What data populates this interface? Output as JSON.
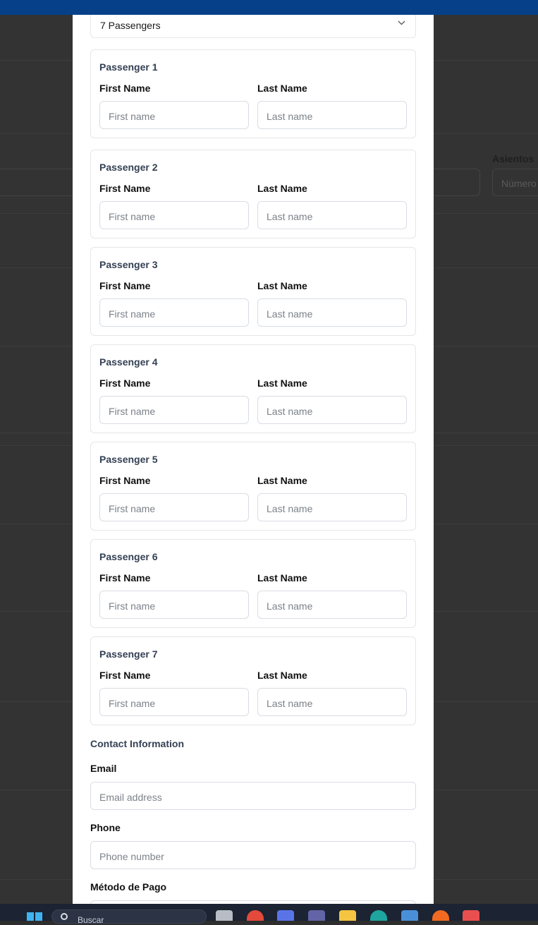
{
  "background": {
    "label": "Asientos",
    "input_placeholder": "Número"
  },
  "form": {
    "passenger_count_select": "7 Passengers",
    "passengers": [
      {
        "title": "Passenger 1",
        "first_label": "First Name",
        "last_label": "Last Name",
        "first_placeholder": "First name",
        "last_placeholder": "Last name"
      },
      {
        "title": "Passenger 2",
        "first_label": "First Name",
        "last_label": "Last Name",
        "first_placeholder": "First name",
        "last_placeholder": "Last name"
      },
      {
        "title": "Passenger 3",
        "first_label": "First Name",
        "last_label": "Last Name",
        "first_placeholder": "First name",
        "last_placeholder": "Last name"
      },
      {
        "title": "Passenger 4",
        "first_label": "First Name",
        "last_label": "Last Name",
        "first_placeholder": "First name",
        "last_placeholder": "Last name"
      },
      {
        "title": "Passenger 5",
        "first_label": "First Name",
        "last_label": "Last Name",
        "first_placeholder": "First name",
        "last_placeholder": "Last name"
      },
      {
        "title": "Passenger 6",
        "first_label": "First Name",
        "last_label": "Last Name",
        "first_placeholder": "First name",
        "last_placeholder": "Last name"
      },
      {
        "title": "Passenger 7",
        "first_label": "First Name",
        "last_label": "Last Name",
        "first_placeholder": "First name",
        "last_placeholder": "Last name"
      }
    ],
    "contact_title": "Contact Information",
    "email_label": "Email",
    "email_placeholder": "Email address",
    "phone_label": "Phone",
    "phone_placeholder": "Phone number",
    "payment_label": "Método de Pago"
  },
  "taskbar": {
    "search_text": "Buscar"
  }
}
